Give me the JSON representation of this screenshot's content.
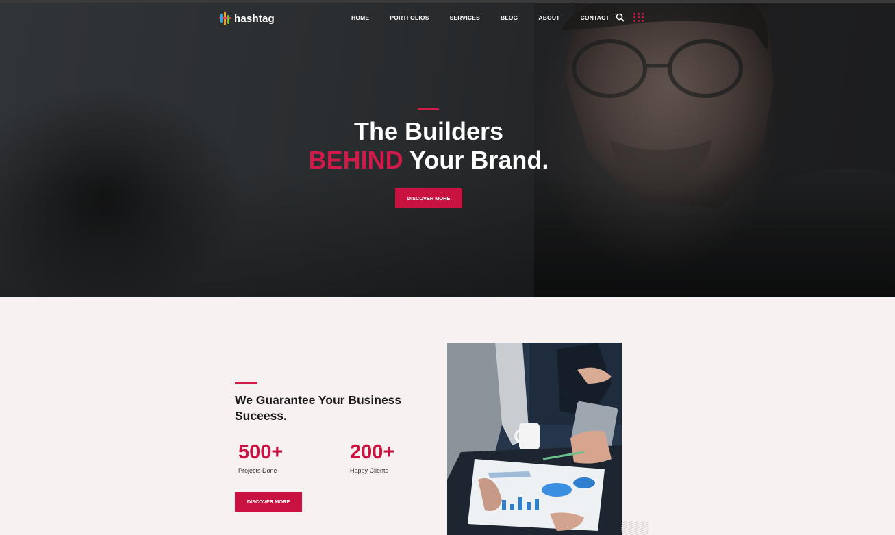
{
  "nav": {
    "logo_text": "hashtag",
    "items": [
      "HOME",
      "PORTFOLIOS",
      "SERVICES",
      "BLOG",
      "ABOUT",
      "CONTACT"
    ],
    "search_icon": "search-icon",
    "menu_icon": "grid-dots-icon"
  },
  "hero": {
    "line1": "The Builders",
    "line2_accent": "BEHIND",
    "line2_rest": " Your Brand.",
    "button_label": "DISCOVER MORE"
  },
  "section": {
    "title": "We Guarantee Your Business Suceess.",
    "stats": [
      {
        "value": "500+",
        "label": "Projects Done"
      },
      {
        "value": "200+",
        "label": "Happy Clients"
      }
    ],
    "button_label": "DISCOVER MORE"
  },
  "colors": {
    "accent": "#c8123f",
    "background": "#f8f1f2",
    "hero_dark": "#2b2e30"
  }
}
